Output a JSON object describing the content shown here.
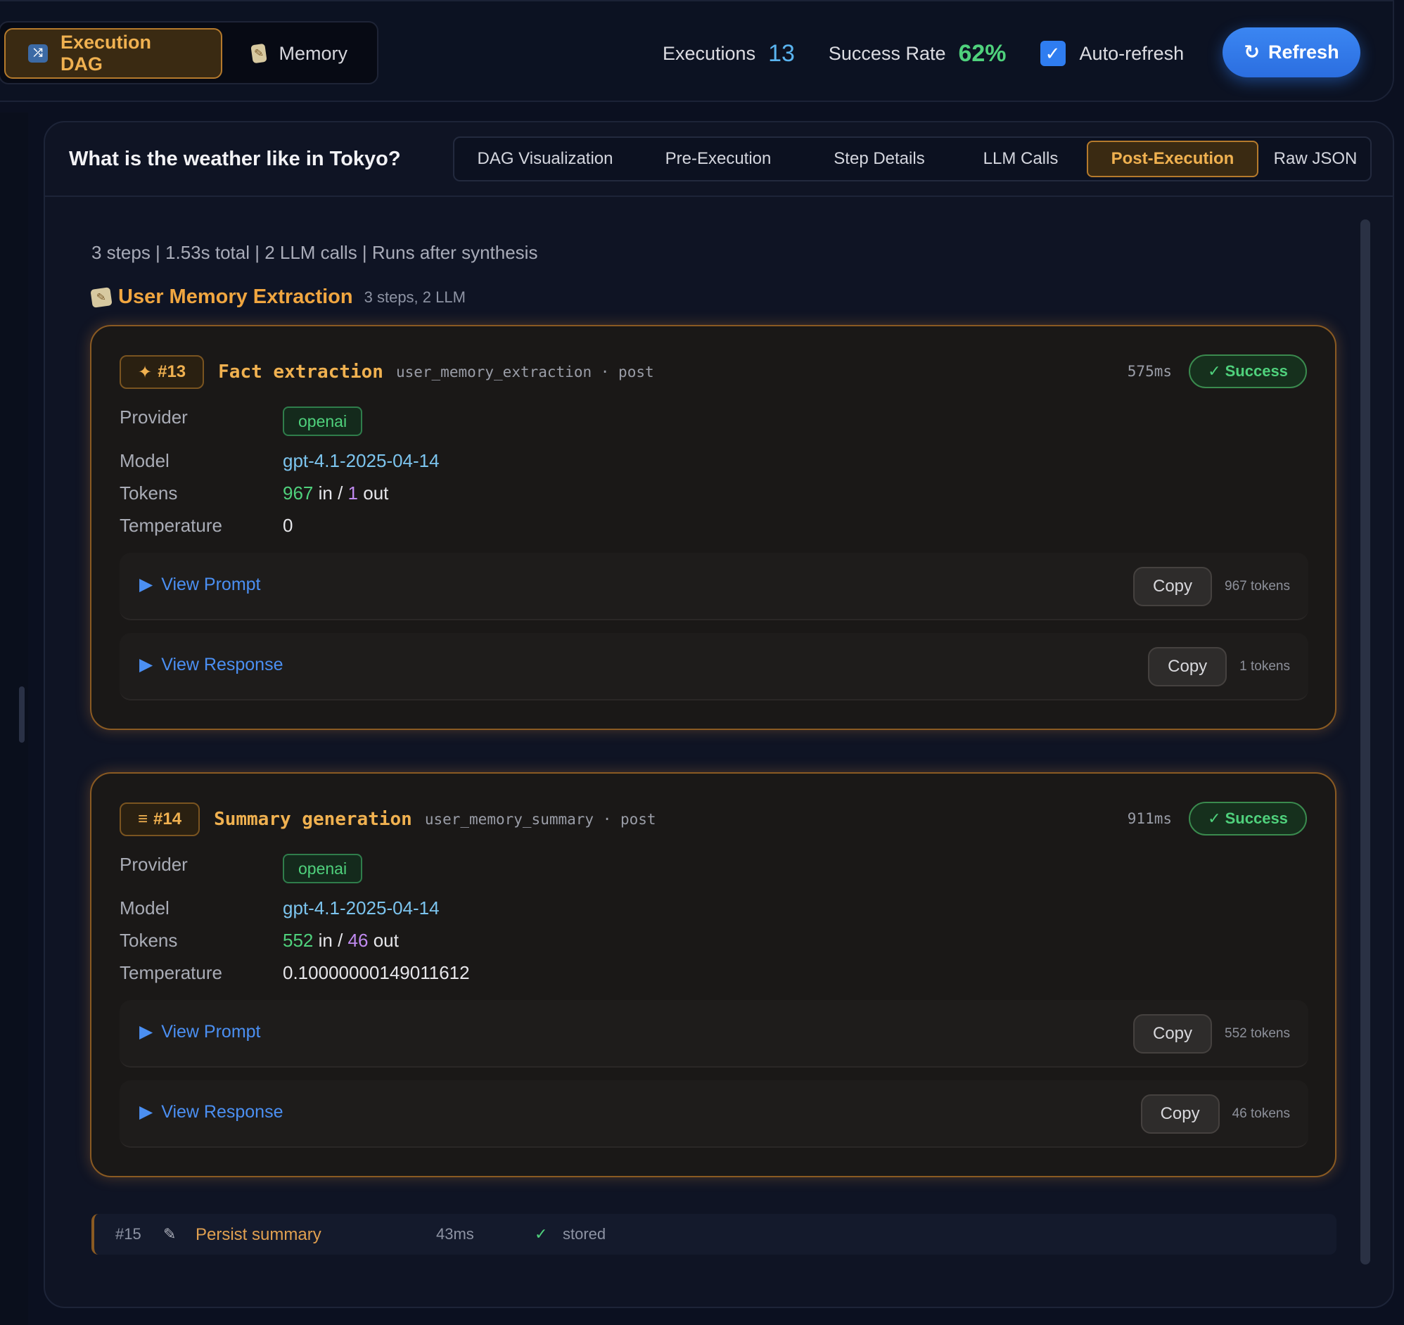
{
  "nav": {
    "views": [
      {
        "label": "Execution DAG",
        "icon": "dag-icon",
        "glyph": "⤮",
        "active": true
      },
      {
        "label": "Memory",
        "icon": "memo-icon",
        "glyph": "✎",
        "active": false
      }
    ]
  },
  "stats": {
    "executions_label": "Executions",
    "executions_value": "13",
    "success_rate_label": "Success Rate",
    "success_rate_value": "62%",
    "auto_refresh_label": "Auto-refresh",
    "auto_refresh_checked": true,
    "checkbox_glyph": "✓",
    "refresh_glyph": "↻",
    "refresh_label": "Refresh"
  },
  "colors": {
    "accent_orange": "#f0b150",
    "accent_blue": "#2f7df0",
    "success_green": "#4fd17c",
    "token_out_purple": "#c08af0",
    "model_blue": "#7cc4ee"
  },
  "query": {
    "text": "What is the weather like in Tokyo?"
  },
  "tabs": [
    {
      "label": "DAG Visualization",
      "active": false
    },
    {
      "label": "Pre-Execution",
      "active": false
    },
    {
      "label": "Step Details",
      "active": false
    },
    {
      "label": "LLM Calls",
      "active": false
    },
    {
      "label": "Post-Execution",
      "active": true
    },
    {
      "label": "Raw JSON",
      "active": false
    }
  ],
  "summary": "3 steps | 1.53s total | 2 LLM calls | Runs after synthesis",
  "section": {
    "icon": "memo-icon",
    "title": "User Memory Extraction",
    "meta": "3 steps, 2 LLM"
  },
  "labels": {
    "provider": "Provider",
    "model": "Model",
    "tokens": "Tokens",
    "temperature": "Temperature",
    "in": "in /",
    "out": "out",
    "view_prompt": "View Prompt",
    "view_response": "View Response",
    "copy": "Copy",
    "toggle_glyph": "▶"
  },
  "steps": [
    {
      "badge_icon": "sparkle-icon",
      "badge_glyph": "✦",
      "number": "#13",
      "name": "Fact extraction",
      "identifier": "user_memory_extraction · post",
      "duration": "575ms",
      "status": "✓ Success",
      "provider": "openai",
      "model": "gpt-4.1-2025-04-14",
      "tokens_in": "967",
      "tokens_out": "1",
      "temperature": "0",
      "prompt_tokens": "967 tokens",
      "response_tokens": "1 tokens"
    },
    {
      "badge_icon": "list-icon",
      "badge_glyph": "≡",
      "number": "#14",
      "name": "Summary generation",
      "identifier": "user_memory_summary · post",
      "duration": "911ms",
      "status": "✓ Success",
      "provider": "openai",
      "model": "gpt-4.1-2025-04-14",
      "tokens_in": "552",
      "tokens_out": "46",
      "temperature": "0.10000000149011612",
      "prompt_tokens": "552 tokens",
      "response_tokens": "46 tokens"
    }
  ],
  "persist": {
    "number": "#15",
    "icon": "pencil-icon",
    "glyph": "✎",
    "name": "Persist summary",
    "duration": "43ms",
    "check_glyph": "✓",
    "status": "stored"
  }
}
